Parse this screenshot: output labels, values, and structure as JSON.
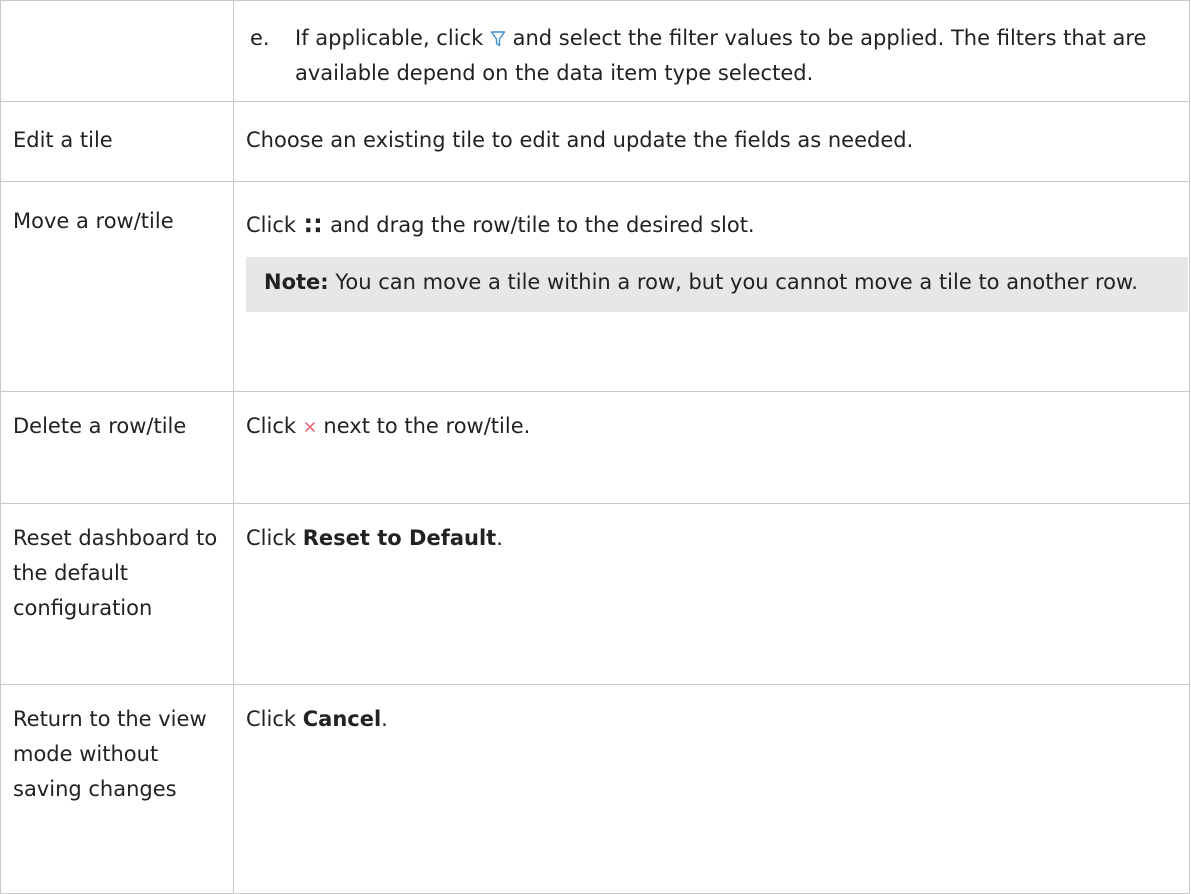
{
  "rows": [
    {
      "action": "",
      "step_letter": "e.",
      "desc_before": "If applicable, click",
      "desc_after": "and select the filter values to be applied. The filters that are available depend on the data item type selected.",
      "icon": "filter-icon"
    },
    {
      "action": "Edit a tile",
      "desc": "Choose an existing tile to edit and update the fields as needed."
    },
    {
      "action": "Move a row/tile",
      "desc_before": "Click",
      "grip_glyph": "∷",
      "desc_after": "and drag the row/tile to the desired slot.",
      "icon": "drag-handle-icon",
      "note_label": "Note:",
      "note_text": "You can move a tile within a row, but you cannot move a tile to another row."
    },
    {
      "action": "Delete a row/tile",
      "desc_before": "Click",
      "desc_after": "next to the row/tile.",
      "icon": "close-icon"
    },
    {
      "action": "Reset dashboard to the default configuration",
      "desc_before": "Click",
      "desc_bold": "Reset to Default",
      "desc_after": "."
    },
    {
      "action": "Return to the view mode without saving changes",
      "desc_before": "Click",
      "desc_bold": "Cancel",
      "desc_after": "."
    }
  ],
  "colors": {
    "filter_icon": "#3b8fd6",
    "close_icon": "#e86a7a",
    "note_background": "#e6e7e8",
    "border": "#c9c9c9"
  }
}
